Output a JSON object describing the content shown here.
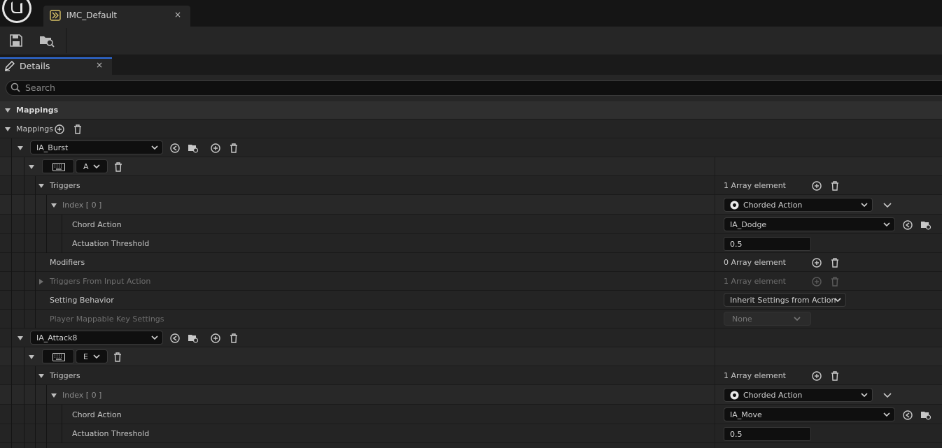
{
  "window": {
    "tab_title": "IMC_Default",
    "tab_close": "×"
  },
  "details": {
    "tab_label": "Details",
    "tab_close": "×",
    "search_placeholder": "Search"
  },
  "sections": {
    "mappings_header": "Mappings",
    "mappings_array": "Mappings"
  },
  "mappings": [
    {
      "action": "IA_Burst",
      "key": "A",
      "triggers_label": "Triggers",
      "triggers_count": "1 Array element",
      "index_label": "Index [ 0 ]",
      "trigger_type": "Chorded Action",
      "chord_action_label": "Chord Action",
      "chord_action_value": "IA_Dodge",
      "actuation_label": "Actuation Threshold",
      "actuation_value": "0.5",
      "modifiers_label": "Modifiers",
      "modifiers_count": "0 Array element",
      "triggers_from_input_label": "Triggers From Input Action",
      "triggers_from_input_count": "1 Array element",
      "setting_behavior_label": "Setting Behavior",
      "setting_behavior_value": "Inherit Settings from Action",
      "player_mappable_label": "Player Mappable Key Settings",
      "player_mappable_value": "None"
    },
    {
      "action": "IA_Attack8",
      "key": "E",
      "triggers_label": "Triggers",
      "triggers_count": "1 Array element",
      "index_label": "Index [ 0 ]",
      "trigger_type": "Chorded Action",
      "chord_action_label": "Chord Action",
      "chord_action_value": "IA_Move",
      "actuation_label": "Actuation Threshold",
      "actuation_value": "0.5"
    }
  ],
  "colors": {
    "accent": "#2f6ee0",
    "background": "#1a1a1a",
    "row": "#242424"
  }
}
